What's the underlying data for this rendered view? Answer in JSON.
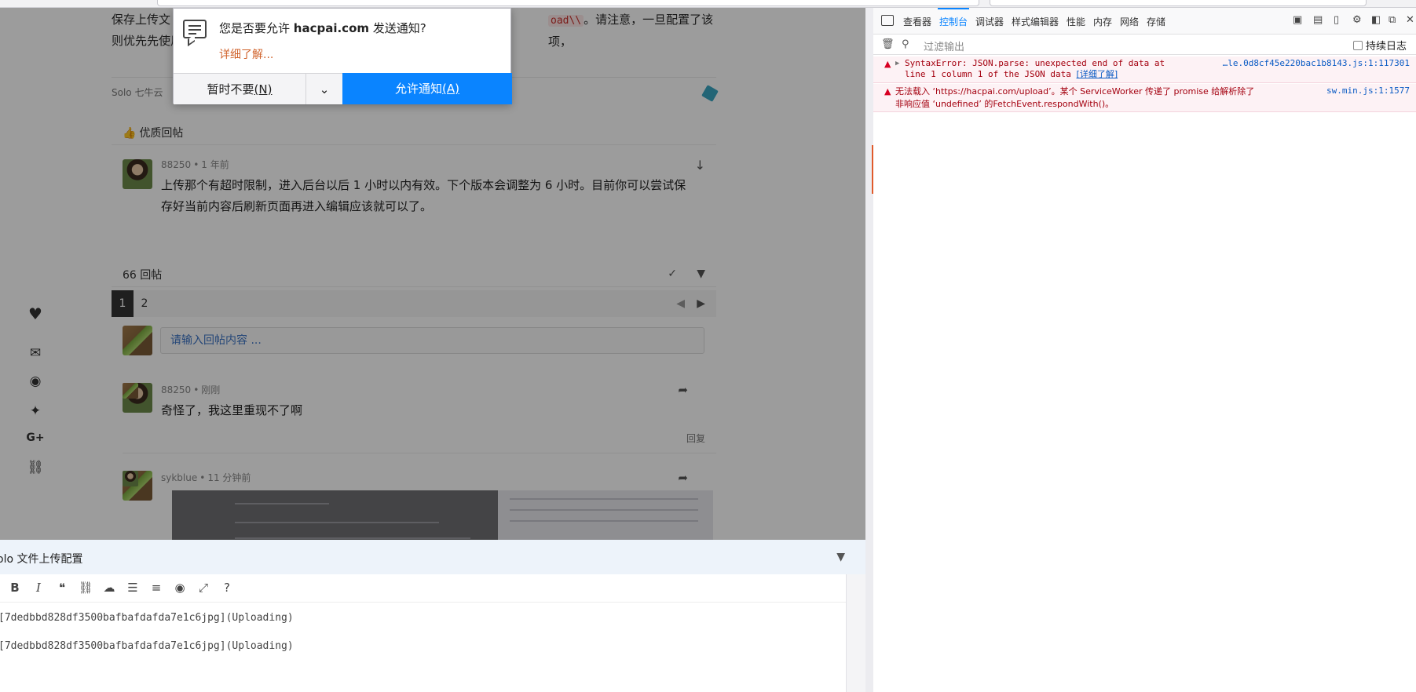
{
  "browser": {},
  "page": {
    "top_text": {
      "line1_prefix": "保存上传文",
      "code": "oad\\\\",
      "line1_suffix": "。请注意，一旦配置了该项，",
      "line2": "则优先先使用"
    },
    "meta": {
      "tags": "Solo  七牛云"
    },
    "good_reply": {
      "title": "优质回帖",
      "comment": {
        "user": "88250",
        "time": "1 年前",
        "body": "上传那个有超时限制，进入后台以后 1 小时以内有效。下个版本会调整为 6 小时。目前你可以尝试保存好当前内容后刷新页面再进入编辑应该就可以了。"
      }
    },
    "replies": {
      "count_label": "66 回帖",
      "pages": [
        "1",
        "2"
      ],
      "input_placeholder": "请输入回帖内容 ...",
      "items": [
        {
          "user": "88250",
          "time": "刚刚",
          "body": "奇怪了，我这里重现不了啊",
          "reply": "回复"
        },
        {
          "user": "sykblue",
          "time": "11 分钟前"
        }
      ]
    },
    "notification": {
      "question_prefix": "您是否要允许 ",
      "domain": "hacpai.com",
      "question_suffix": " 发送通知?",
      "learn_more": "详细了解...",
      "deny_label": "暂时不要",
      "deny_key": "(N)",
      "allow_label": "允许通知",
      "allow_key": "(A)"
    }
  },
  "editor": {
    "title": "olo 文件上传配置",
    "lines": [
      "[7dedbbd828df3500bafbafdafda7e1c6jpg](Uploading)",
      "[7dedbbd828df3500bafbafdafda7e1c6jpg](Uploading)"
    ]
  },
  "devtools": {
    "tabs": [
      "查看器",
      "控制台",
      "调试器",
      "样式编辑器",
      "性能",
      "内存",
      "网络",
      "存储"
    ],
    "selected_tab": "控制台",
    "filter_placeholder": "过滤输出",
    "persist_logs": "持续日志",
    "messages": [
      {
        "text_line1": "SyntaxError: JSON.parse: unexpected end of data at",
        "text_line2": "line 1 column 1 of the JSON data",
        "learn_more": "[详细了解]",
        "source": "…le.0d8cf45e220bac1b8143.js:1:117301"
      },
      {
        "text_line1": "无法载入 ‘https://hacpai.com/upload’。某个 ServiceWorker 传递了 promise 给解析除了",
        "text_line2": "非响应值 ‘undefined’ 的FetchEvent.respondWith()。",
        "source": "sw.min.js:1:1577"
      }
    ]
  },
  "colors": {
    "accent": "#0a84ff",
    "error_text": "#a4000f",
    "error_bg": "#fdf2f5",
    "link_orange": "#d0632c"
  }
}
